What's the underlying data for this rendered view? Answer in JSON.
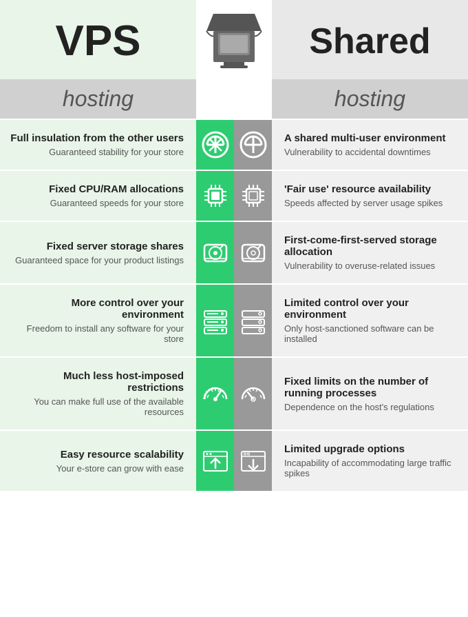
{
  "header": {
    "vps_title": "VPS",
    "shared_title": "Shared",
    "hosting_label": "hosting"
  },
  "rows": [
    {
      "vps_main": "Full insulation from the other users",
      "vps_sub": "Guaranteed stability for your store",
      "shared_main": "A shared multi-user environment",
      "shared_sub": "Vulnerability to accidental downtimes",
      "icon": "shield"
    },
    {
      "vps_main": "Fixed CPU/RAM allocations",
      "vps_sub": "Guaranteed speeds for your store",
      "shared_main": "'Fair use' resource availability",
      "shared_sub": "Speeds affected by server usage spikes",
      "icon": "chip"
    },
    {
      "vps_main": "Fixed server storage shares",
      "vps_sub": "Guaranteed space for your product listings",
      "shared_main": "First-come-first-served storage allocation",
      "shared_sub": "Vulnerability to overuse-related issues",
      "icon": "hdd"
    },
    {
      "vps_main": "More control over your environment",
      "vps_sub": "Freedom to install any software for your store",
      "shared_main": "Limited control over your environment",
      "shared_sub": "Only host-sanctioned software can be installed",
      "icon": "server"
    },
    {
      "vps_main": "Much less host-imposed restrictions",
      "vps_sub": "You can make full use of the available resources",
      "shared_main": "Fixed limits on the number of running processes",
      "shared_sub": "Dependence on the host's regulations",
      "icon": "speedometer"
    },
    {
      "vps_main": "Easy resource scalability",
      "vps_sub": "Your e-store can grow with ease",
      "shared_main": "Limited upgrade options",
      "shared_sub": "Incapability of accommodating large traffic spikes",
      "icon": "upload"
    }
  ]
}
